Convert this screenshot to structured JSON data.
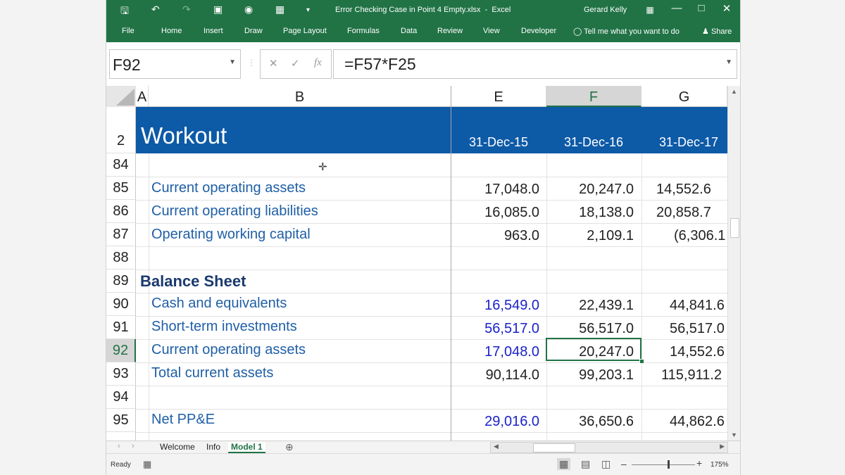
{
  "titlebar": {
    "document_title": "Error Checking Case in Point 4 Empty.xlsx",
    "app_name": "Excel",
    "title_separator": "-",
    "user": "Gerard Kelly"
  },
  "ribbon": {
    "tabs": [
      "File",
      "Home",
      "Insert",
      "Draw",
      "Page Layout",
      "Formulas",
      "Data",
      "Review",
      "View",
      "Developer"
    ],
    "tell_me": "Tell me what you want to do",
    "share": "Share"
  },
  "formula_bar": {
    "name_box": "F92",
    "formula": "=F57*F25"
  },
  "columns": [
    "A",
    "B",
    "E",
    "F",
    "G"
  ],
  "header_row": {
    "row_number": "2",
    "title": "Workout",
    "dates": [
      "31-Dec-15",
      "31-Dec-16",
      "31-Dec-17"
    ]
  },
  "rows": [
    {
      "num": "84",
      "label": "",
      "values": [
        "",
        "",
        ""
      ]
    },
    {
      "num": "85",
      "label": "Current operating assets",
      "values": [
        "17,048.0",
        "20,247.0",
        "14,552.6"
      ]
    },
    {
      "num": "86",
      "label": "Current operating liabilities",
      "values": [
        "16,085.0",
        "18,138.0",
        "20,858.7"
      ]
    },
    {
      "num": "87",
      "label": "Operating working capital",
      "values": [
        "963.0",
        "2,109.1",
        "(6,306.1"
      ]
    },
    {
      "num": "88",
      "label": "",
      "values": [
        "",
        "",
        ""
      ]
    },
    {
      "num": "89",
      "label": "Balance Sheet",
      "values": [
        "",
        "",
        ""
      ]
    },
    {
      "num": "90",
      "label": "Cash and equivalents",
      "values": [
        "16,549.0",
        "22,439.1",
        "44,841.6"
      ]
    },
    {
      "num": "91",
      "label": "Short-term investments",
      "values": [
        "56,517.0",
        "56,517.0",
        "56,517.0"
      ]
    },
    {
      "num": "92",
      "label": "Current operating assets",
      "values": [
        "17,048.0",
        "20,247.0",
        "14,552.6"
      ]
    },
    {
      "num": "93",
      "label": "Total current assets",
      "values": [
        "90,114.0",
        "99,203.1",
        "115,911.2"
      ]
    },
    {
      "num": "94",
      "label": "",
      "values": [
        "",
        "",
        ""
      ]
    },
    {
      "num": "95",
      "label": "Net PP&E",
      "values": [
        "29,016.0",
        "36,650.6",
        "44,862.6"
      ]
    }
  ],
  "sheet_tabs": [
    "Welcome",
    "Info",
    "Model 1"
  ],
  "active_sheet": "Model 1",
  "status": {
    "ready": "Ready",
    "zoom": "175%"
  },
  "colors": {
    "excel_green": "#217346",
    "header_band": "#0d5aa7",
    "input_blue": "#1a22c8",
    "label_blue": "#1f5fa6"
  },
  "icons": {
    "save": "save-icon",
    "undo": "undo-icon",
    "redo": "redo-icon",
    "touch": "touch-mode-icon",
    "camera": "camera-icon",
    "calculator": "calculator-icon",
    "customize": "customize-qat-icon",
    "ribbon_options": "ribbon-display-icon",
    "minimize": "minimize-icon",
    "maximize": "maximize-icon",
    "close": "close-icon",
    "lightbulb": "lightbulb-icon",
    "share": "share-icon"
  }
}
